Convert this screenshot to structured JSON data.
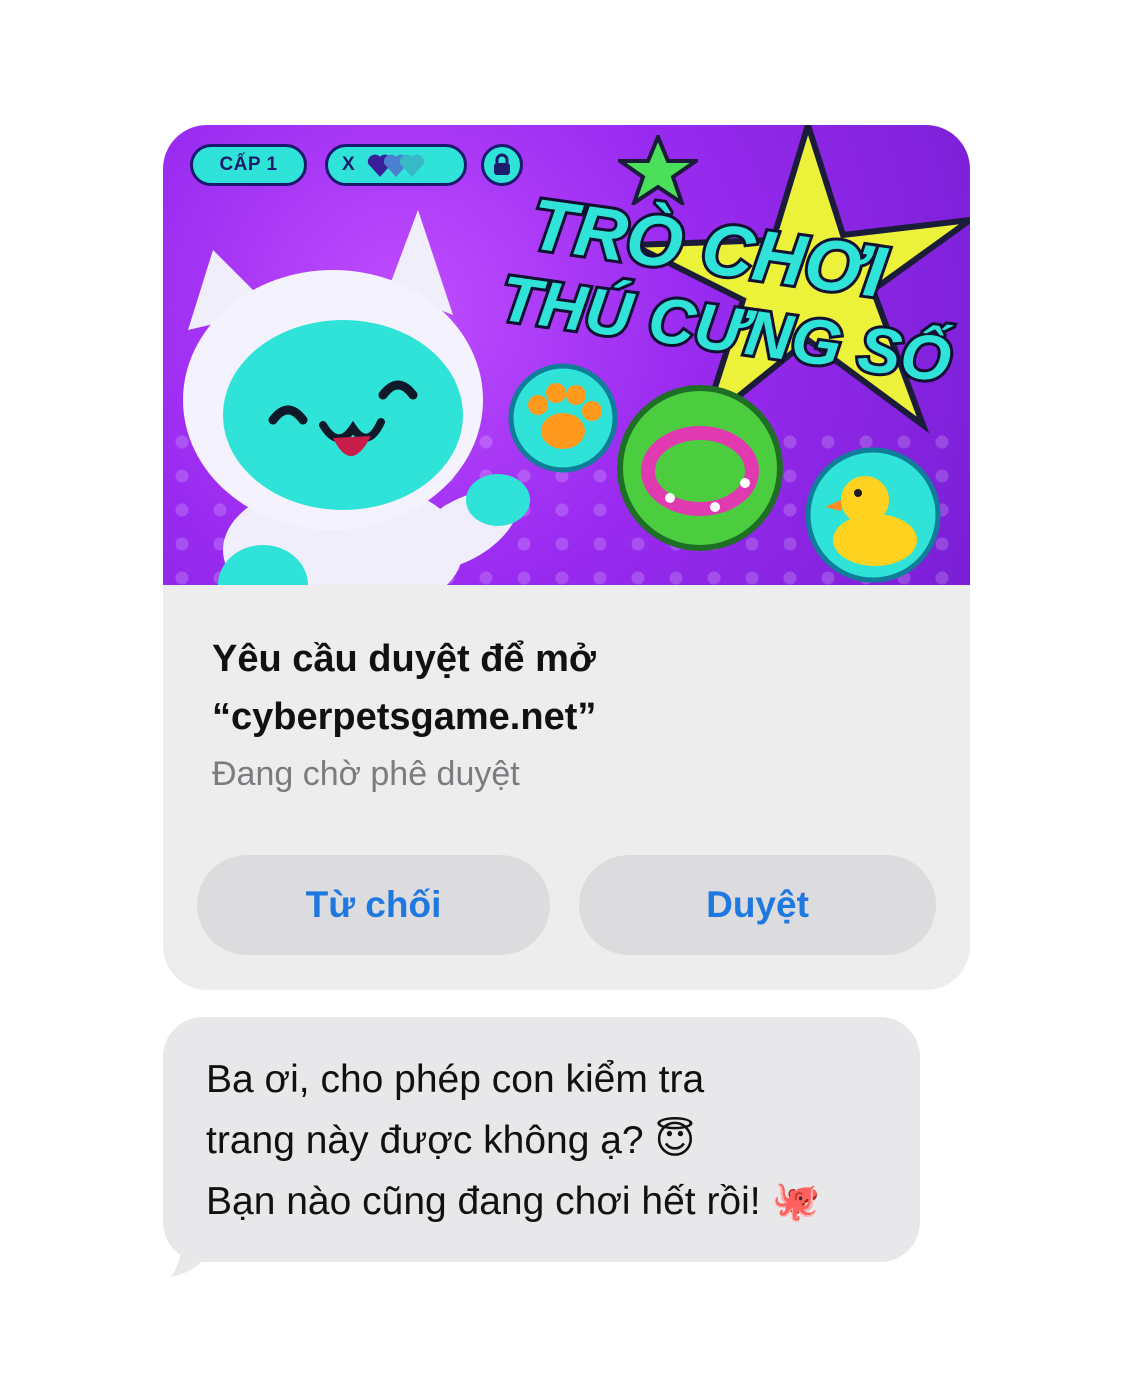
{
  "banner": {
    "level_label": "CẤP 1",
    "multiplier_label": "X",
    "title_line1": "TRÒ CHƠI",
    "title_line2": "THÚ CƯNG SỐ"
  },
  "request": {
    "title": "Yêu cầu duyệt để mở “cyberpetsgame.net”",
    "status": "Đang chờ phê duyệt",
    "decline_label": "Từ chối",
    "approve_label": "Duyệt"
  },
  "message": {
    "text": "Ba ơi, cho phép con kiểm tra\ntrang này được không ạ? 😇\nBạn nào cũng đang chơi hết rồi! 🐙"
  },
  "colors": {
    "accent": "#1f78e0",
    "banner_purple": "#9a2bf0",
    "banner_cyan": "#2fe3d8",
    "star_yellow": "#ecf23a"
  },
  "icons": [
    "heart-icon",
    "lock-icon",
    "star-icon",
    "paw-icon",
    "collar-icon",
    "duck-icon",
    "pet-character"
  ]
}
